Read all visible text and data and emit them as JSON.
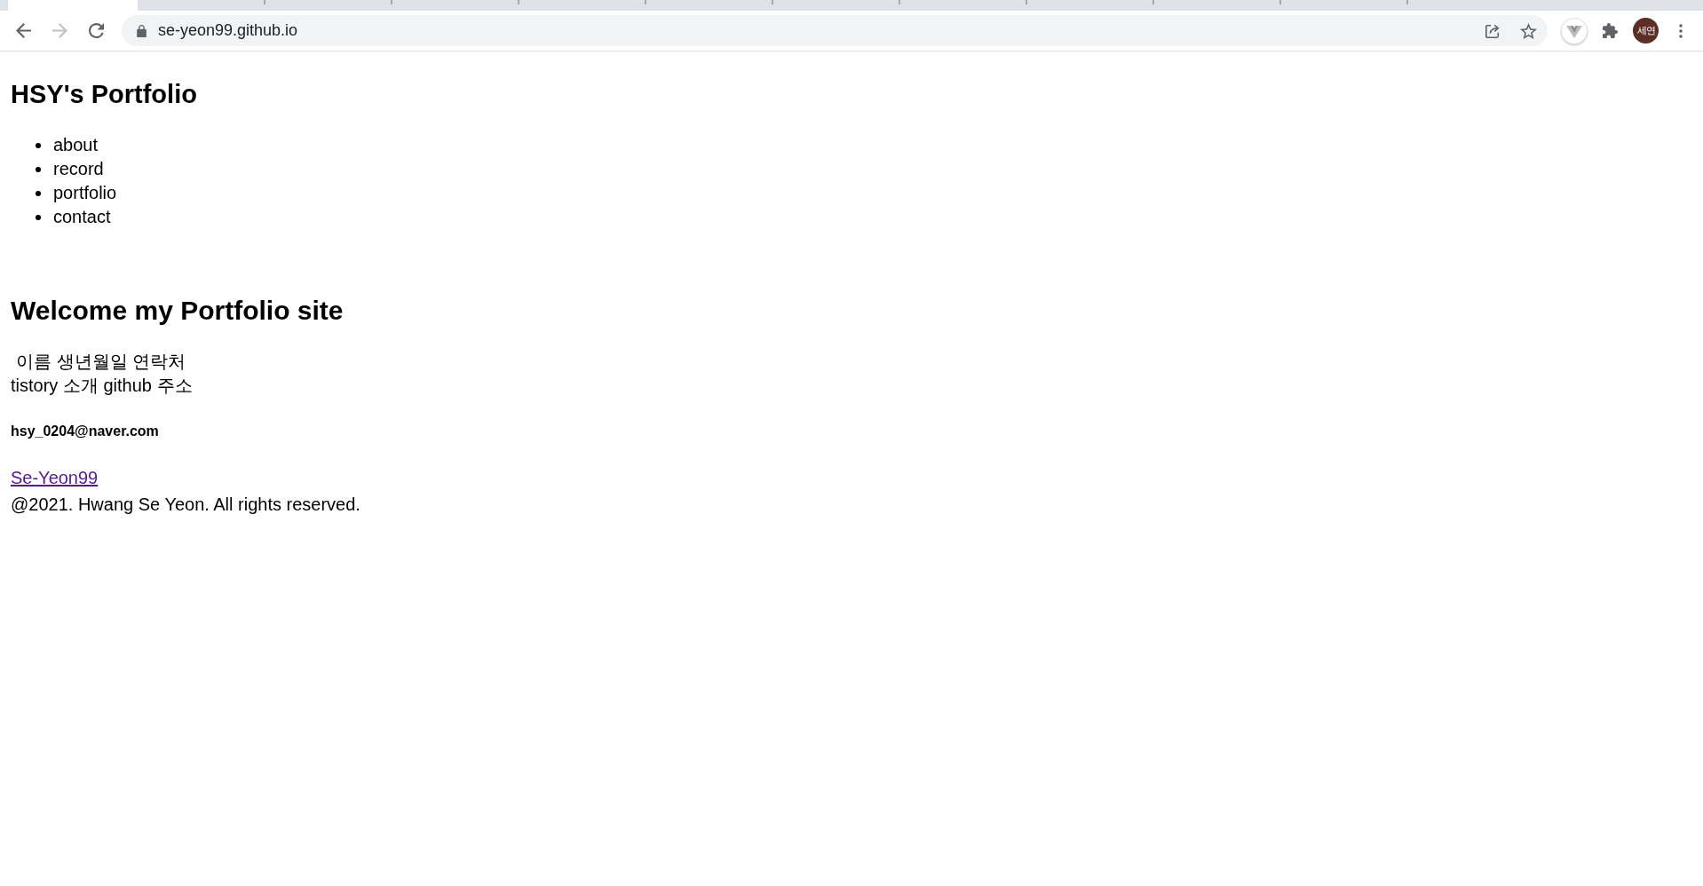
{
  "browser": {
    "tabs": [
      {
        "selected": true
      },
      {
        "selected": false
      },
      {
        "selected": false
      },
      {
        "selected": false
      },
      {
        "selected": false
      },
      {
        "selected": false
      },
      {
        "selected": false
      },
      {
        "selected": false
      },
      {
        "selected": false
      },
      {
        "selected": false
      },
      {
        "selected": false
      },
      {
        "selected": false
      }
    ],
    "nav_buttons": [
      {
        "kind": "back",
        "disabled": false
      },
      {
        "kind": "forward",
        "disabled": true
      },
      {
        "kind": "reload",
        "disabled": false
      }
    ],
    "address": "se-yeon99.github.io",
    "profile": "세연"
  },
  "page": {
    "title": "HSY's Portfolio",
    "nav": [
      "about",
      "record",
      "portfolio",
      "contact"
    ],
    "welcome": {
      "heading": "Welcome my Portfolio site",
      "lines": [
        "이름 생년월일 연락처",
        "tistory 소개 github 주소"
      ]
    },
    "footer": {
      "email": "hsy_0204@naver.com",
      "link": {
        "text": "Se-Yeon99",
        "visited": true
      },
      "copyright": "@2021. Hwang Se Yeon. All rights reserved."
    }
  }
}
